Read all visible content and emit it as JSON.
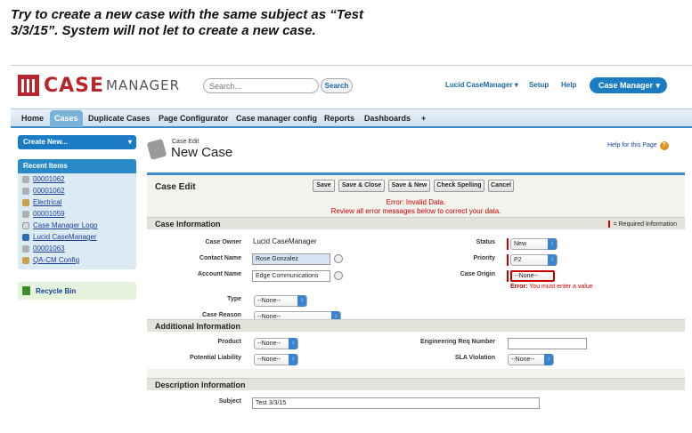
{
  "caption": {
    "line1": "Try to create a new case with the same subject as “Test",
    "line2": "3/3/15”. System will not let to create a new case."
  },
  "header": {
    "logo_case": "CASE",
    "logo_manager": "MANAGER",
    "search_placeholder": "Search...",
    "search_button": "Search",
    "user_menu": "Lucid CaseManager ▾",
    "setup": "Setup",
    "help": "Help",
    "app_menu": "Case Manager",
    "app_menu_arrow": "▾"
  },
  "tabs": [
    {
      "label": "Home"
    },
    {
      "label": "Cases",
      "active": true
    },
    {
      "label": "Duplicate Cases"
    },
    {
      "label": "Page Configurator"
    },
    {
      "label": "Case manager config"
    },
    {
      "label": "Reports"
    },
    {
      "label": "Dashboards"
    },
    {
      "label": "+"
    }
  ],
  "sidebar": {
    "create_new": "Create New...",
    "create_new_arrow": "▾",
    "recent_title": "Recent Items",
    "recent_items": [
      {
        "label": "00001062",
        "icon": "case-icon",
        "color": "#b0b0b0"
      },
      {
        "label": "00001062",
        "icon": "case-icon",
        "color": "#b0b0b0"
      },
      {
        "label": "Electrical",
        "icon": "config-icon",
        "color": "#c8a24a"
      },
      {
        "label": "00001059",
        "icon": "case-icon",
        "color": "#b0b0b0"
      },
      {
        "label": "Case Manager Logo",
        "icon": "document-icon",
        "color": "#d8d8d8"
      },
      {
        "label": "Lucid CaseManager",
        "icon": "user-icon",
        "color": "#2e6db4"
      },
      {
        "label": "00001063",
        "icon": "case-icon",
        "color": "#b0b0b0"
      },
      {
        "label": "QA-CM Config",
        "icon": "config-icon",
        "color": "#c8a24a"
      }
    ],
    "recycle_bin": "Recycle Bin"
  },
  "page": {
    "kicker": "Case Edit",
    "title": "New Case",
    "help_link": "Help for this Page",
    "help_icon": "?"
  },
  "form": {
    "title": "Case Edit",
    "buttons": {
      "save": "Save",
      "save_close": "Save & Close",
      "save_new": "Save & New",
      "spell": "Check Spelling",
      "cancel": "Cancel"
    },
    "error_line1": "Error: Invalid Data.",
    "error_line2": "Review all error messages below to correct your data.",
    "sections": {
      "case_info": "Case Information",
      "required_legend": "= Required Information",
      "additional": "Additional Information",
      "description": "Description Information"
    },
    "fields": {
      "case_owner_label": "Case Owner",
      "case_owner_value": "Lucid CaseManager",
      "contact_name_label": "Contact Name",
      "contact_name_value": "Rose Gonzalez",
      "account_name_label": "Account Name",
      "account_name_value": "Edge Communications",
      "type_label": "Type",
      "type_value": "--None--",
      "case_reason_label": "Case Reason",
      "case_reason_value": "--None--",
      "status_label": "Status",
      "status_value": "New",
      "priority_label": "Priority",
      "priority_value": "P2",
      "case_origin_label": "Case Origin",
      "case_origin_value": "--None--",
      "case_origin_error_prefix": "Error:",
      "case_origin_error": "You must enter a value",
      "product_label": "Product",
      "product_value": "--None--",
      "liability_label": "Potential Liability",
      "liability_value": "--None--",
      "eng_req_label": "Engineering Req Number",
      "eng_req_value": "",
      "sla_label": "SLA Violation",
      "sla_value": "--None--",
      "subject_label": "Subject",
      "subject_value": "Test 3/3/15"
    },
    "select_knob": "↕"
  },
  "colors": {
    "brand_red": "#b8262b",
    "accent_blue": "#1b7cc3",
    "error_red": "#cc0000"
  }
}
